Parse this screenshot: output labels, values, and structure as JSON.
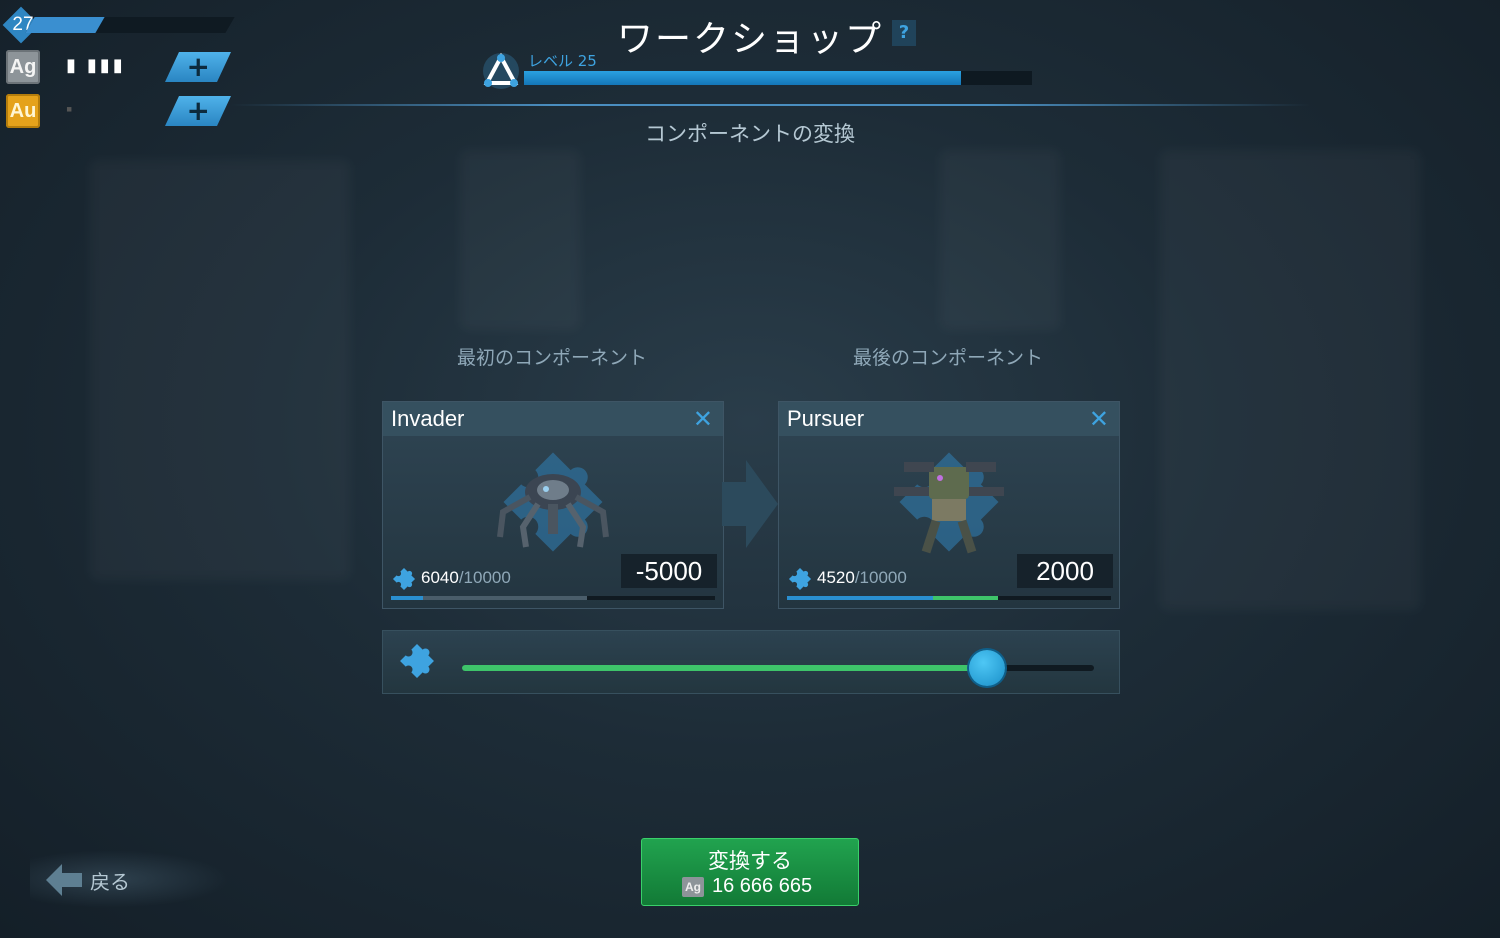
{
  "player": {
    "level": "27",
    "xp_progress": 0.35,
    "silver_value": "▮ ▮▮▮",
    "gold_value": "▪"
  },
  "header": {
    "title": "ワークショップ",
    "help": "?",
    "level_label": "レベル 25",
    "level_progress": 0.86,
    "subtitle": "コンポーネントの変換"
  },
  "first": {
    "section_label": "最初のコンポーネント",
    "name": "Invader",
    "fragments": "6040",
    "fragments_max": "/10000",
    "delta": "-5000",
    "bar_current": 0.1,
    "bar_remaining": 0.604
  },
  "last": {
    "section_label": "最後のコンポーネント",
    "name": "Pursuer",
    "fragments": "4520",
    "fragments_max": "/10000",
    "delta": "2000",
    "bar_current": 0.452,
    "bar_gain": 0.2
  },
  "slider": {
    "value": 0.83
  },
  "back_label": "戻る",
  "convert": {
    "label": "変換する",
    "currency_icon": "Ag",
    "cost": "16 666 665"
  },
  "colors": {
    "accent": "#3ea3e0",
    "gain": "#3ec46a",
    "button": "#21a34f"
  }
}
